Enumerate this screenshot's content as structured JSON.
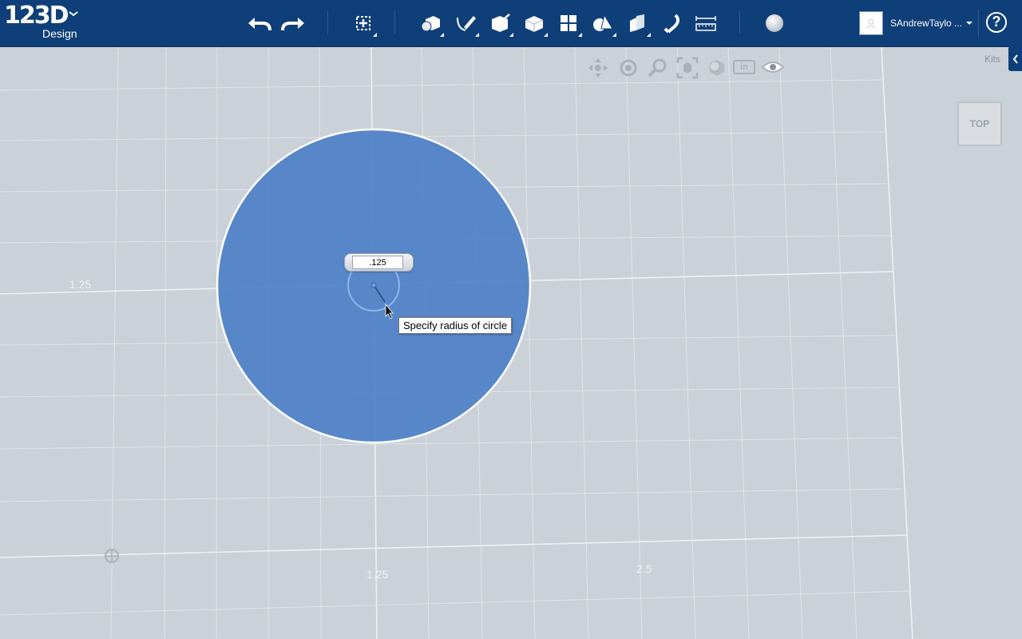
{
  "app": {
    "logo_main": "123D",
    "logo_sub": "Design"
  },
  "toolbar": {
    "tools": [
      {
        "icon": "undo-icon"
      },
      {
        "icon": "redo-icon"
      },
      {
        "icon": "transform-icon"
      },
      {
        "icon": "primitives-icon"
      },
      {
        "icon": "sketch-icon"
      },
      {
        "icon": "construct-icon"
      },
      {
        "icon": "modify-icon"
      },
      {
        "icon": "pattern-icon"
      },
      {
        "icon": "grouping-icon"
      },
      {
        "icon": "combine-icon"
      },
      {
        "icon": "snap-icon"
      },
      {
        "icon": "measure-icon"
      },
      {
        "icon": "material-icon"
      }
    ]
  },
  "account": {
    "username": "SAndrewTaylo ...",
    "help_symbol": "?"
  },
  "navigation": {
    "tools": [
      "pan-icon",
      "orbit-icon",
      "zoom-icon",
      "fit-icon",
      "view-mode-icon",
      "units-toggle",
      "visibility-icon"
    ],
    "units_label": "in"
  },
  "kits": {
    "label": "Kits"
  },
  "view_cube": {
    "label": "TOP"
  },
  "sketch": {
    "radius_value": ".125",
    "tooltip": "Specify radius of circle",
    "fill_color": "#4f82c8",
    "edge_color": "#ffffff"
  },
  "grid": {
    "labels": [
      "1.25",
      "1.25",
      "2.5"
    ]
  },
  "colors": {
    "toolbar_bg": "#0f3f78",
    "canvas_bg": "#cbd1d8"
  }
}
